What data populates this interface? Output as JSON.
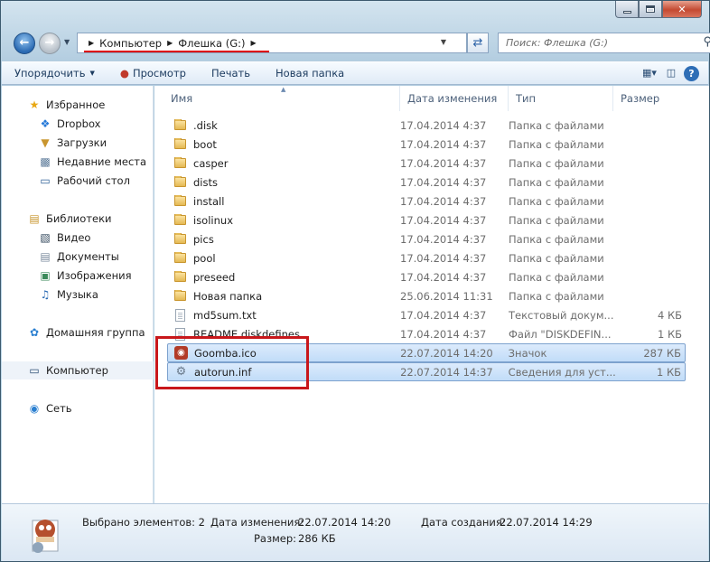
{
  "window": {
    "min_label": "",
    "max_label": "",
    "close_label": "✕"
  },
  "address": {
    "crumbs": [
      "Компьютер",
      "Флешка (G:)"
    ],
    "search_placeholder": "Поиск: Флешка (G:)"
  },
  "toolbar": {
    "organize": "Упорядочить",
    "preview": "Просмотр",
    "print": "Печать",
    "new_folder": "Новая папка",
    "help": "?"
  },
  "sidebar": {
    "favorites": "Избранное",
    "dropbox": "Dropbox",
    "downloads": "Загрузки",
    "recent": "Недавние места",
    "desktop": "Рабочий стол",
    "libraries": "Библиотеки",
    "video": "Видео",
    "documents": "Документы",
    "images": "Изображения",
    "music": "Музыка",
    "homegroup": "Домашняя группа",
    "computer": "Компьютер",
    "network": "Сеть"
  },
  "columns": {
    "name": "Имя",
    "date": "Дата изменения",
    "type": "Тип",
    "size": "Размер"
  },
  "files": [
    {
      "name": ".disk",
      "date": "17.04.2014 4:37",
      "type": "Папка с файлами",
      "size": "",
      "icon": "folder"
    },
    {
      "name": "boot",
      "date": "17.04.2014 4:37",
      "type": "Папка с файлами",
      "size": "",
      "icon": "folder"
    },
    {
      "name": "casper",
      "date": "17.04.2014 4:37",
      "type": "Папка с файлами",
      "size": "",
      "icon": "folder"
    },
    {
      "name": "dists",
      "date": "17.04.2014 4:37",
      "type": "Папка с файлами",
      "size": "",
      "icon": "folder"
    },
    {
      "name": "install",
      "date": "17.04.2014 4:37",
      "type": "Папка с файлами",
      "size": "",
      "icon": "folder"
    },
    {
      "name": "isolinux",
      "date": "17.04.2014 4:37",
      "type": "Папка с файлами",
      "size": "",
      "icon": "folder"
    },
    {
      "name": "pics",
      "date": "17.04.2014 4:37",
      "type": "Папка с файлами",
      "size": "",
      "icon": "folder"
    },
    {
      "name": "pool",
      "date": "17.04.2014 4:37",
      "type": "Папка с файлами",
      "size": "",
      "icon": "folder"
    },
    {
      "name": "preseed",
      "date": "17.04.2014 4:37",
      "type": "Папка с файлами",
      "size": "",
      "icon": "folder"
    },
    {
      "name": "Новая папка",
      "date": "25.06.2014 11:31",
      "type": "Папка с файлами",
      "size": "",
      "icon": "folder"
    },
    {
      "name": "md5sum.txt",
      "date": "17.04.2014 4:37",
      "type": "Текстовый докум...",
      "size": "4 КБ",
      "icon": "document"
    },
    {
      "name": "README.diskdefines",
      "date": "17.04.2014 4:37",
      "type": "Файл \"DISKDEFIN...",
      "size": "1 КБ",
      "icon": "document"
    },
    {
      "name": "Goomba.ico",
      "date": "22.07.2014 14:20",
      "type": "Значок",
      "size": "287 КБ",
      "icon": "ico"
    },
    {
      "name": "autorun.inf",
      "date": "22.07.2014 14:37",
      "type": "Сведения для уст...",
      "size": "1 КБ",
      "icon": "settings"
    }
  ],
  "status": {
    "selected": "Выбрано элементов: 2",
    "date_mod_label": "Дата изменения:",
    "date_mod": "22.07.2014 14:20",
    "date_created_label": "Дата создания:",
    "date_created": "22.07.2014 14:29",
    "size_label": "Размер:",
    "size": "286 КБ"
  },
  "colors": {
    "selection": "#c1dcf8",
    "highlight_box": "#c8171b",
    "accent": "#2e6eb6"
  }
}
